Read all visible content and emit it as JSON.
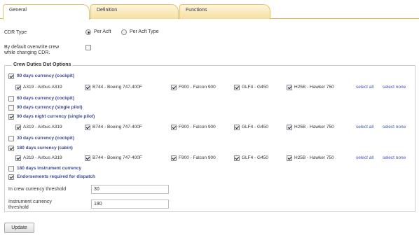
{
  "tabs": [
    "General",
    "Definition",
    "Functions"
  ],
  "cdr_type": {
    "label": "CDR Type",
    "options": [
      "Per Acft",
      "Per Acft Type"
    ]
  },
  "overwrite": {
    "label_line1": "By default overwrite crew",
    "label_line2": "while changing CDR."
  },
  "crew_duties": {
    "legend": "Crew Duties Dut Options",
    "items": [
      "90 days currency (cockpit)",
      "60 days currency (cockpit)",
      "90 days currency (single pilot)",
      "90 days night currency (single pilot)",
      "30 days currency (cockpit)",
      "180 days currency (cabin)",
      "180 days instrument currency",
      "Endorsements required for dispatch"
    ],
    "aircraft": [
      "A319 - Airbus A319",
      "B744 - Boeing 747-400F",
      "F900 - Falcon 900",
      "GLF4 - G450",
      "H25B - Hawker 750"
    ],
    "select_all": "select all",
    "select_none": "select none"
  },
  "thresholds": {
    "crew_label": "In crew currency threshold",
    "crew_value": "30",
    "instrument_label_line1": "Instrument currency",
    "instrument_label_line2": "threshold",
    "instrument_value": "180"
  },
  "update_label": "Update"
}
